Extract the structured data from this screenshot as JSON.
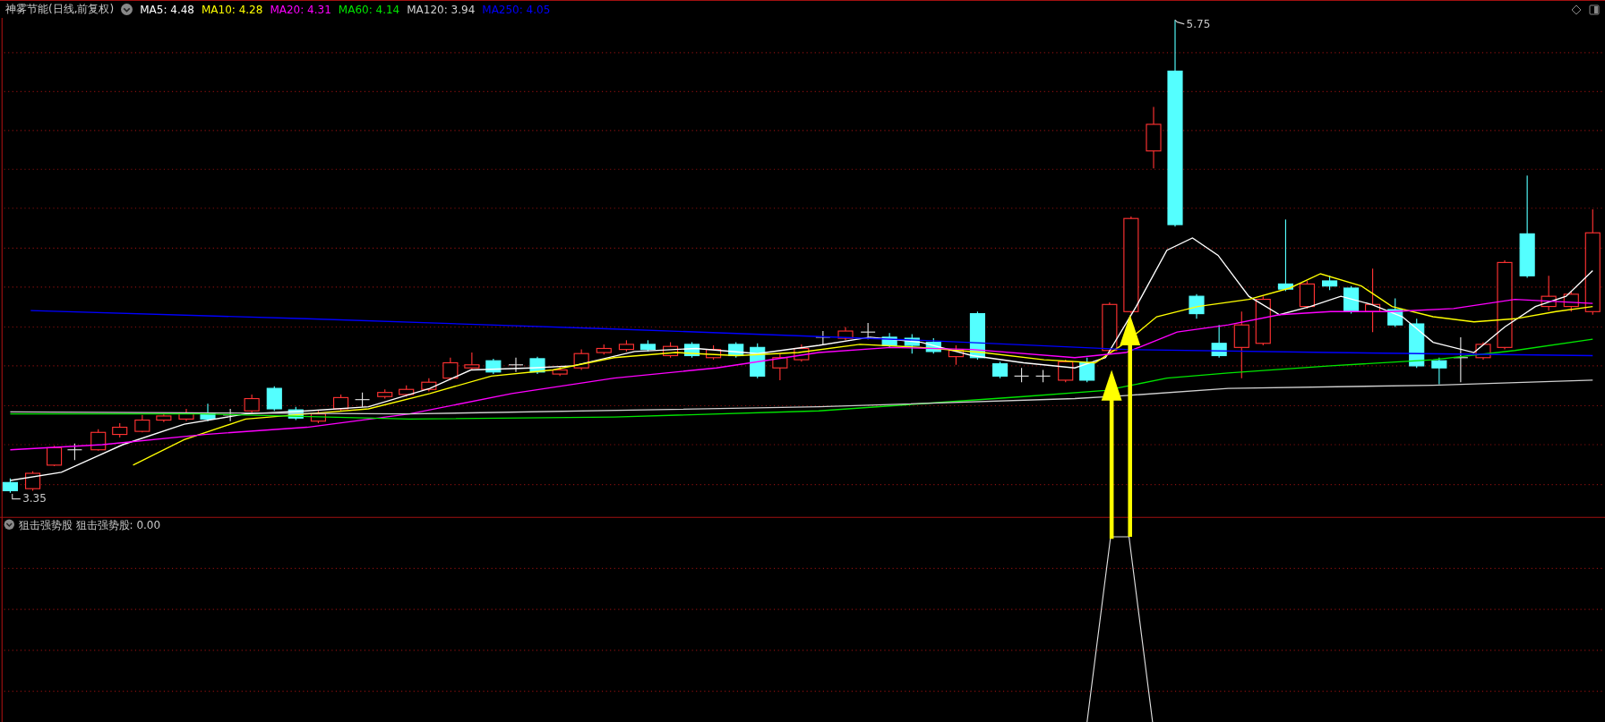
{
  "chart_header": {
    "title": "神雾节能(日线,前复权)",
    "moving_averages": [
      {
        "label": "MA5: 4.48",
        "color": "#ffffff"
      },
      {
        "label": "MA10: 4.28",
        "color": "#ffff00"
      },
      {
        "label": "MA20: 4.31",
        "color": "#ff00ff"
      },
      {
        "label": "MA60: 4.14",
        "color": "#00e600"
      },
      {
        "label": "MA120: 3.94",
        "color": "#d0d0d0"
      },
      {
        "label": "MA250: 4.05",
        "color": "#0000ff"
      }
    ]
  },
  "price_chart": {
    "high_label": "5.75",
    "low_label": "3.35"
  },
  "indicator_panel": {
    "name": "狙击强势股",
    "reading": "狙击强势股: 0.00"
  }
}
